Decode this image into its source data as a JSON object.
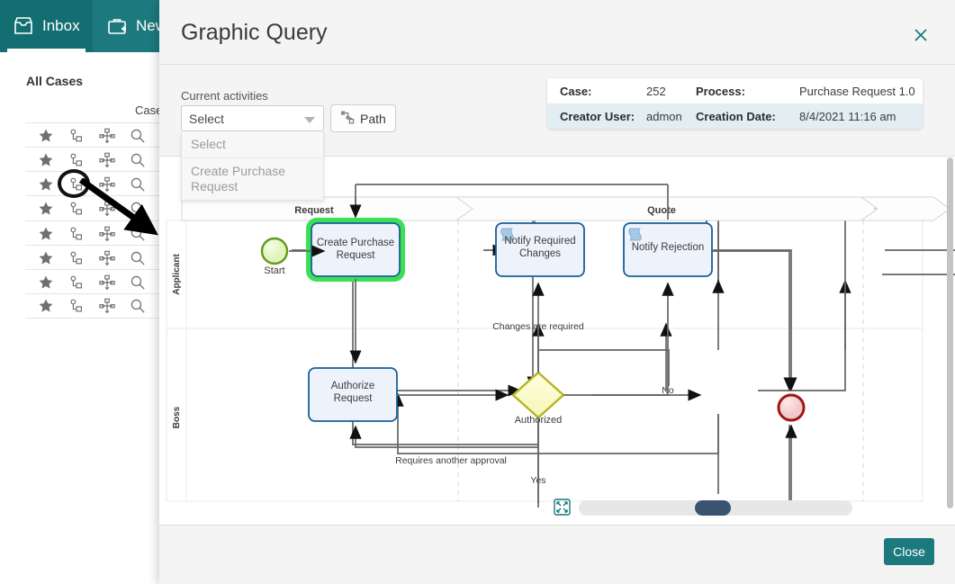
{
  "background_app": {
    "tabs": [
      {
        "label": "Inbox",
        "icon": "inbox-icon",
        "active": true
      },
      {
        "label": "New C",
        "icon": "briefcase-plus-icon",
        "active": false
      }
    ],
    "section_title": "All Cases",
    "table_column_header": "Case",
    "row_icons": [
      "star-icon",
      "workflow-icon",
      "process-map-icon",
      "search-icon"
    ],
    "row_count": 8
  },
  "annotation": {
    "circle_target": "workflow-icon",
    "arrow": "pointer-arrow"
  },
  "modal": {
    "title": "Graphic Query",
    "close_icon": "close-icon",
    "field_label": "Current activities",
    "select": {
      "value": "Select",
      "caret_icon": "chevron-down-icon",
      "options": [
        "Select",
        "Create Purchase Request"
      ]
    },
    "path_button": {
      "label": "Path",
      "icon": "path-icon"
    },
    "info": {
      "rows": [
        {
          "k1": "Case:",
          "v1": "252",
          "k2": "Process:",
          "v2": "Purchase Request 1.0"
        },
        {
          "k1": "Creator User:",
          "v1": "admon",
          "k2": "Creation Date:",
          "v2": "8/4/2021 11:16 am"
        }
      ]
    },
    "footer": {
      "close_label": "Close"
    },
    "zoom": {
      "fit_icon": "fit-to-screen-icon"
    }
  },
  "diagram": {
    "type": "bpmn",
    "phases": [
      "Request",
      "Quote"
    ],
    "lanes": [
      "Applicant",
      "Boss"
    ],
    "nodes": [
      {
        "id": "start",
        "type": "start-event",
        "label": "Start",
        "highlight": false
      },
      {
        "id": "create",
        "type": "task",
        "label": "Create Purchase Request",
        "highlight": true
      },
      {
        "id": "notify_changes",
        "type": "script-task",
        "label": "Notify Required Changes",
        "highlight": false
      },
      {
        "id": "notify_rejection",
        "type": "script-task",
        "label": "Notify Rejection",
        "highlight": false
      },
      {
        "id": "authorize",
        "type": "task",
        "label": "Authorize Request",
        "highlight": false
      },
      {
        "id": "gateway",
        "type": "exclusive-gateway",
        "label": "Authorized",
        "highlight": false
      },
      {
        "id": "end",
        "type": "end-event",
        "label": "",
        "highlight": false
      }
    ],
    "edge_labels": [
      "Changes are required",
      "Requires another approval",
      "No",
      "Yes"
    ],
    "colors": {
      "task_fill": "#eef2fb",
      "task_stroke": "#16609a",
      "highlight": "#3de055",
      "gateway_fill": "#fbfbcf",
      "gateway_stroke": "#b5b522",
      "start_fill": "#eaf7c8",
      "start_stroke": "#5f9c1f",
      "end_fill": "#f6d8d8",
      "end_stroke": "#9e1717",
      "connector": "#666666"
    }
  },
  "theme": {
    "accent": "#1c7a7e",
    "modal_bg": "#f4f4f4"
  }
}
